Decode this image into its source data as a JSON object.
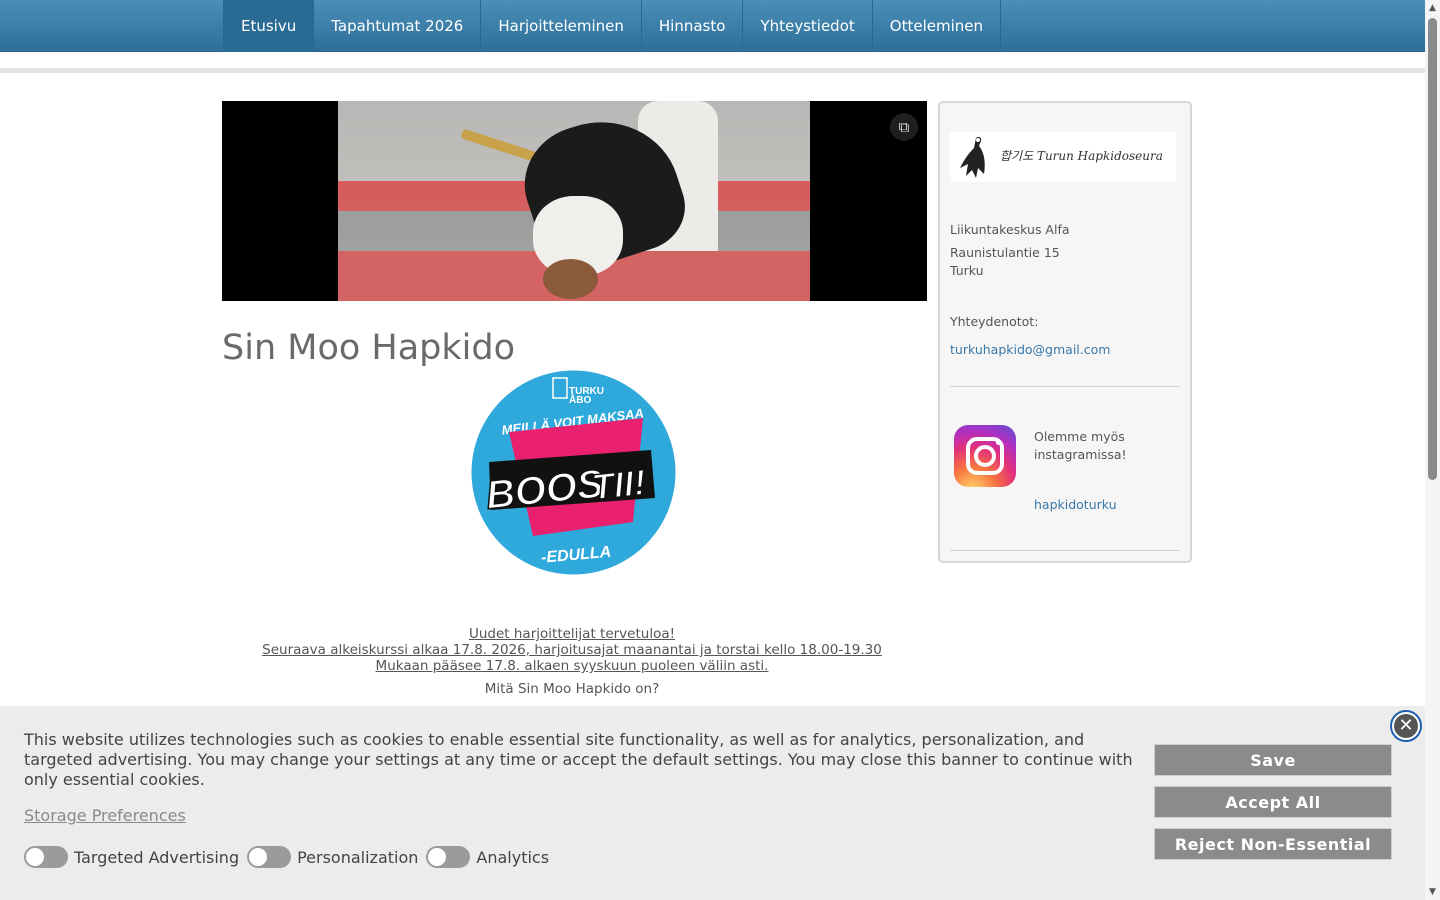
{
  "nav": {
    "items": [
      {
        "label": "Etusivu",
        "active": true
      },
      {
        "label": "Tapahtumat 2026"
      },
      {
        "label": "Harjoitteleminen"
      },
      {
        "label": "Hinnasto"
      },
      {
        "label": "Yhteystiedot"
      },
      {
        "label": "Otteleminen"
      }
    ]
  },
  "hero": {
    "expand_icon": "external-link-icon"
  },
  "main": {
    "title": "Sin Moo Hapkido",
    "intro_line1": "Uudet harjoittelijat tervetuloa!",
    "intro_line2": "Seuraava alkeiskurssi alkaa 17.8. 2026, harjoitusajat maanantai ja torstai kello 18.00-19.30",
    "intro_line3": "Mukaan pääsee 17.8. alkaen syyskuun puoleen väliin asti.",
    "question": "Mitä Sin Moo Hapkido on?"
  },
  "badge": {
    "city1": "TURKU",
    "city2": "ÅBO",
    "top": "MEILLÄ VOIT MAKSAA",
    "word1": "BOOS",
    "word2": "TII!",
    "bottom": "-EDULLA"
  },
  "sidebar": {
    "logo_text": "합기도 Turun Hapkidoseura",
    "venue": "Liikuntakeskus Alfa",
    "street": "Raunistulantie 15",
    "city": "Turku",
    "contact_label": "Yhteydenotot:",
    "email": "turkuhapkido@gmail.com",
    "insta_text": "Olemme myös instagramissa!",
    "insta_handle": "hapkidoturku"
  },
  "cookie": {
    "text": "This website utilizes technologies such as cookies to enable essential site functionality, as well as for analytics, personalization, and targeted advertising. You may change your settings at any time or accept the default settings. You may close this banner to continue with only essential cookies.",
    "storage_link": "Storage Preferences",
    "toggle_targeted": "Targeted Advertising",
    "toggle_personalization": "Personalization",
    "toggle_analytics": "Analytics",
    "save": "Save",
    "accept_all": "Accept All",
    "reject": "Reject Non-Essential",
    "close_symbol": "✕"
  },
  "colors": {
    "nav": "#3a7fab",
    "link": "#3a78a8",
    "button": "#8b8b8b"
  }
}
